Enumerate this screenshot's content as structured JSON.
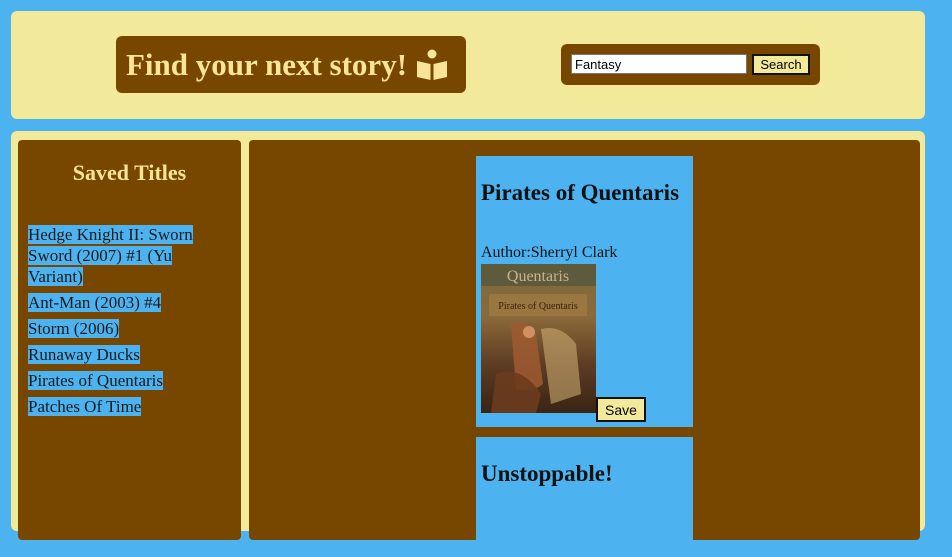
{
  "header": {
    "title": "Find your next story!",
    "title_icon": "open-book-icon",
    "search": {
      "value": "Fantasy",
      "button_label": "Search"
    }
  },
  "sidebar": {
    "heading": "Saved Titles",
    "items": [
      "Hedge Knight II: Sworn Sword (2007) #1 (Yu Variant)",
      "Ant-Man (2003) #4",
      "Storm (2006)",
      "Runaway Ducks",
      "Pirates of Quentaris",
      "Patches Of Time"
    ]
  },
  "results": [
    {
      "title": "Pirates of Quentaris",
      "author": "Author:Sherryl Clark",
      "cover_text": "Quentaris",
      "cover_subtitle": "Pirates of Quentaris",
      "save_label": "Save"
    },
    {
      "title": "Unstoppable!"
    }
  ],
  "colors": {
    "page_bg": "#4cb3f0",
    "panel_bg": "#f2e99b",
    "brown": "#774700",
    "gold_text": "#f9e59a",
    "highlight": "#4cb3f0"
  }
}
